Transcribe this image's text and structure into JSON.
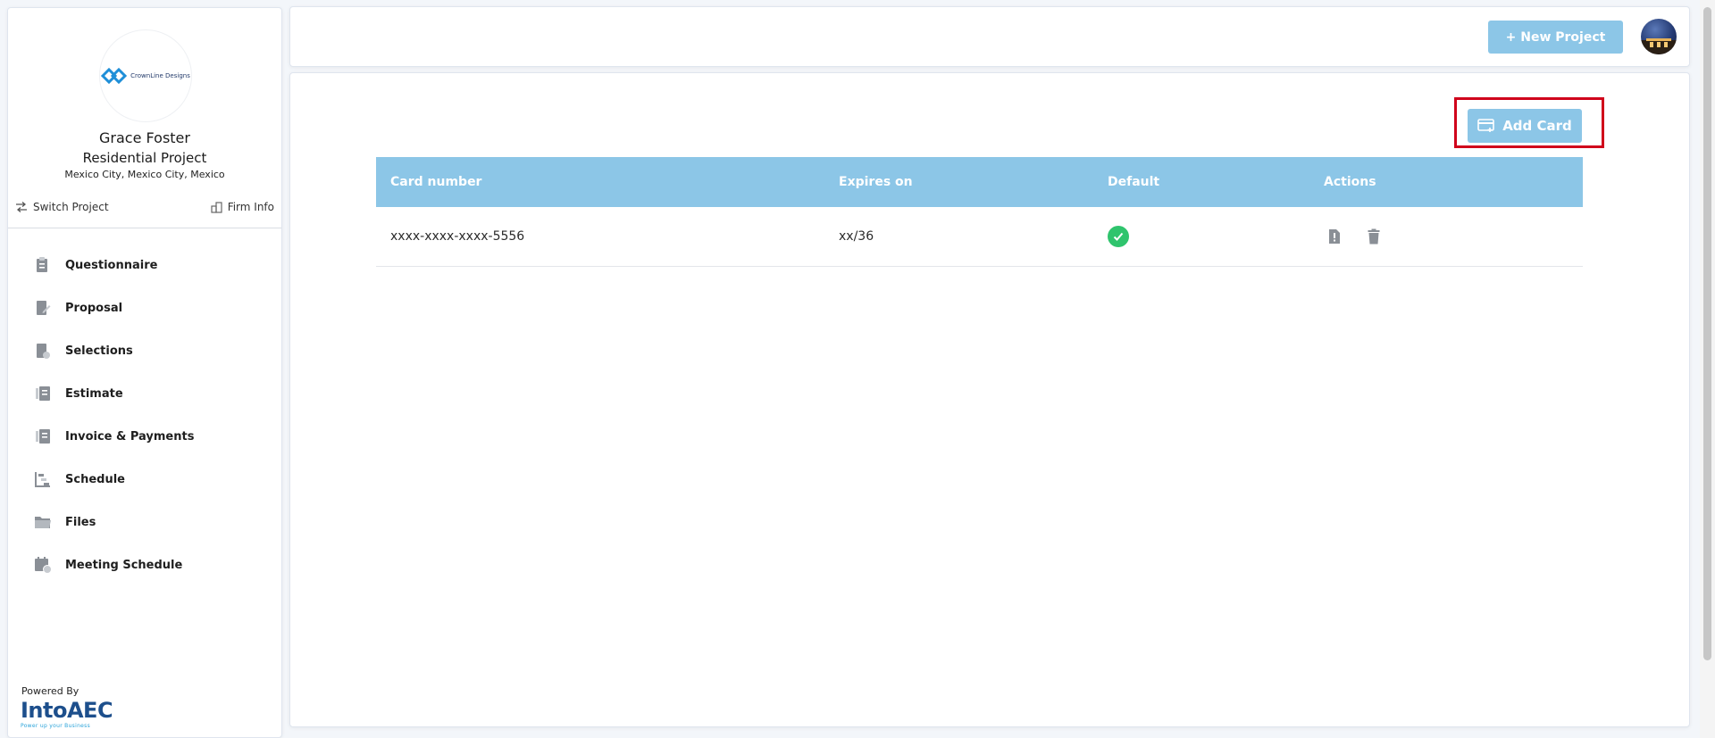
{
  "sidebar": {
    "logo_text": "CrownLine Designs",
    "client_name": "Grace Foster",
    "project_name": "Residential Project",
    "project_location": "Mexico City, Mexico City, Mexico",
    "switch_project_label": "Switch Project",
    "firm_info_label": "Firm Info",
    "nav_items": [
      {
        "label": "Questionnaire",
        "icon": "questionnaire-icon"
      },
      {
        "label": "Proposal",
        "icon": "proposal-icon"
      },
      {
        "label": "Selections",
        "icon": "selections-icon"
      },
      {
        "label": "Estimate",
        "icon": "estimate-icon"
      },
      {
        "label": "Invoice & Payments",
        "icon": "invoice-icon"
      },
      {
        "label": "Schedule",
        "icon": "schedule-icon"
      },
      {
        "label": "Files",
        "icon": "folder-icon"
      },
      {
        "label": "Meeting Schedule",
        "icon": "calendar-icon"
      }
    ],
    "powered_by_label": "Powered By",
    "brand_name": "IntoAEC",
    "brand_tagline": "Power up your Business"
  },
  "topbar": {
    "new_project_label": "+ New Project"
  },
  "main": {
    "add_card_label": "Add Card",
    "table": {
      "headers": {
        "card_number": "Card number",
        "expires_on": "Expires on",
        "default": "Default",
        "actions": "Actions"
      },
      "rows": [
        {
          "card_number": "xxxx-xxxx-xxxx-5556",
          "expires_on": "xx/36",
          "default": true
        }
      ]
    }
  },
  "colors": {
    "accent": "#8cc6e7",
    "highlight": "#d0021b",
    "success": "#2fc46d",
    "icon_gray": "#8a8f96"
  }
}
